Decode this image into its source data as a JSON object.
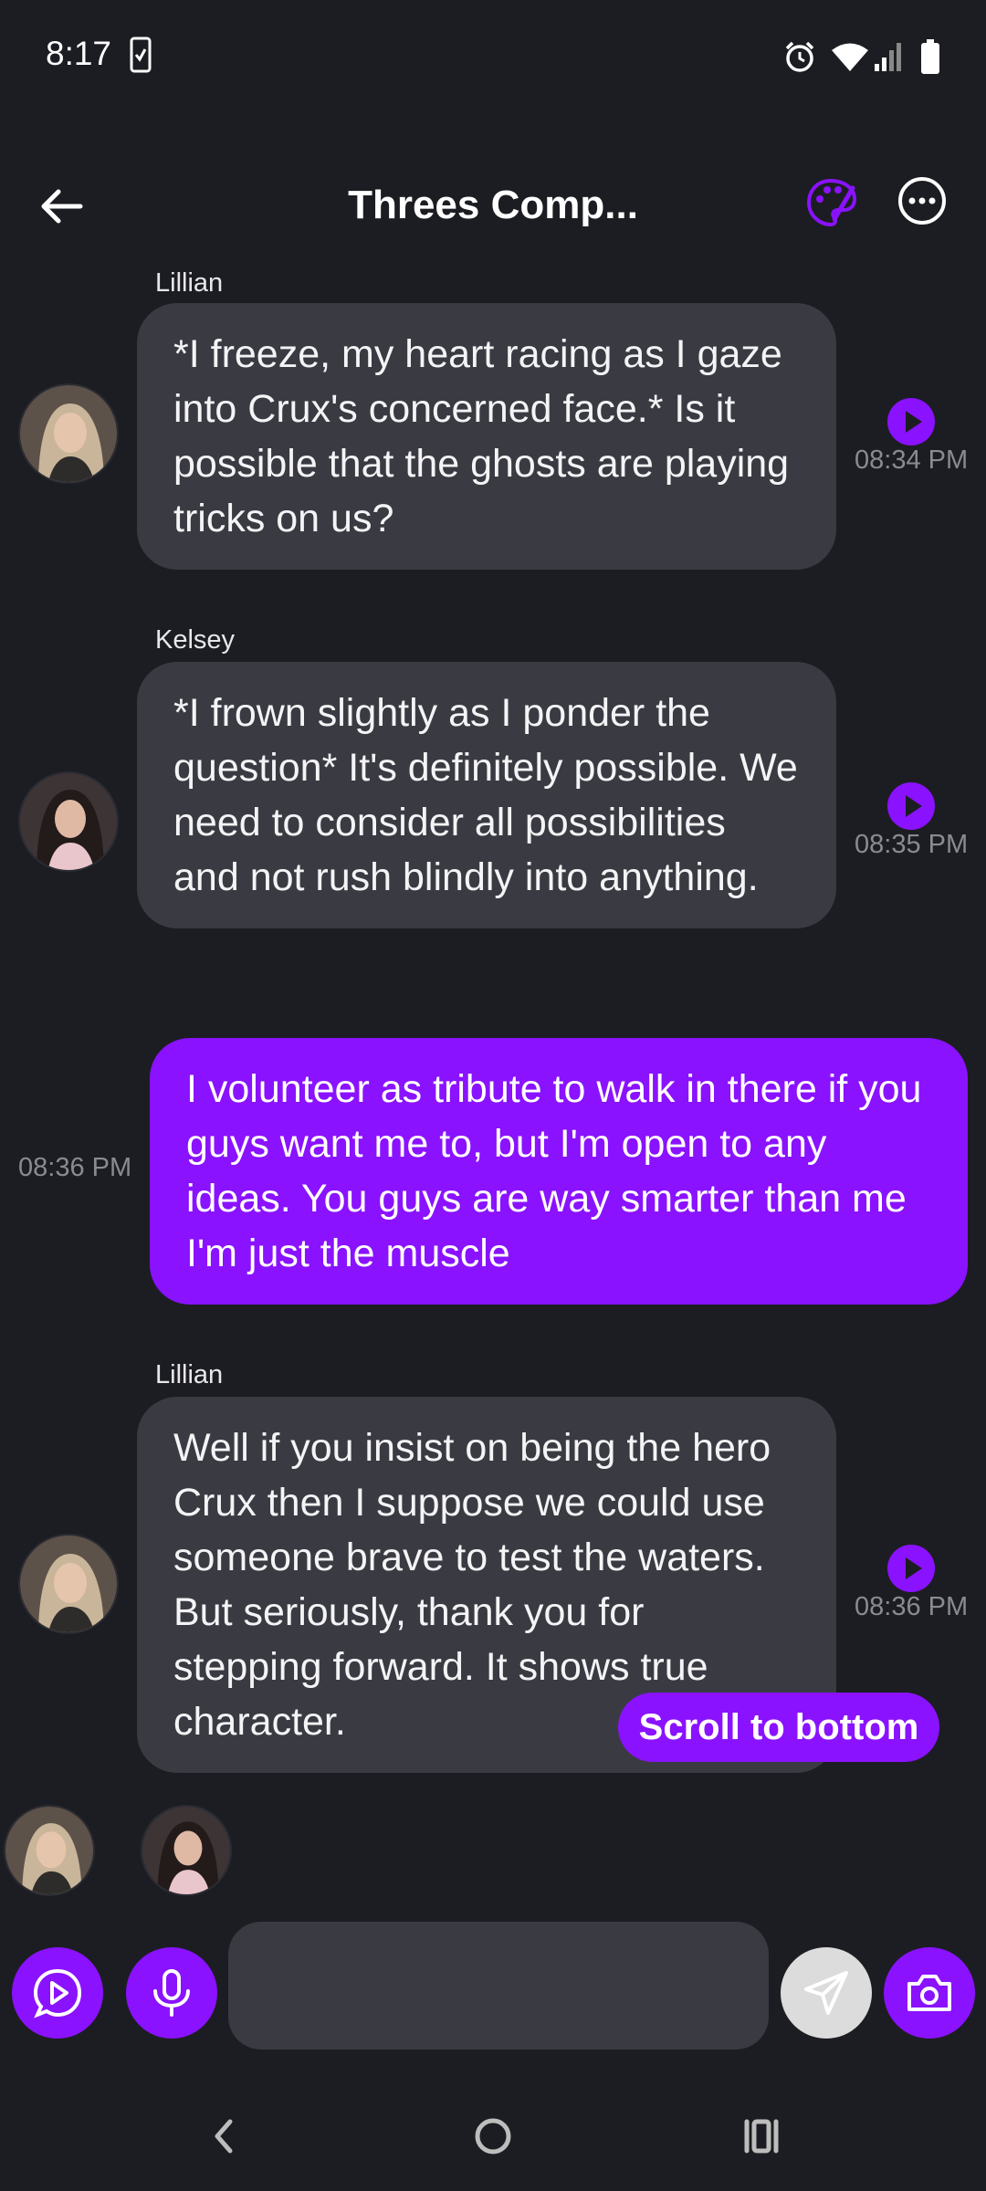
{
  "status_bar": {
    "time": "8:17"
  },
  "header": {
    "title": "Threes Comp..."
  },
  "messages": [
    {
      "sender": "Lillian",
      "text": "*I freeze, my heart racing as I gaze into Crux's concerned face.* Is it possible that the ghosts are playing tricks on us?",
      "time": "08:34 PM"
    },
    {
      "sender": "Kelsey",
      "text": "*I frown slightly as I ponder the question* It's definitely possible. We need to consider all possibilities and not rush blindly into anything.",
      "time": "08:35 PM"
    },
    {
      "sender": "",
      "text": "I volunteer as tribute to walk in there if you guys want me to, but I'm open to any ideas. You guys are way smarter than me I'm just the muscle",
      "time": "08:36 PM"
    },
    {
      "sender": "Lillian",
      "text": "Well if you insist on being the hero Crux then I suppose we could use someone brave to test the waters. But seriously, thank you for stepping forward. It shows true character.",
      "time": "08:36 PM"
    }
  ],
  "scroll_to_bottom": "Scroll to bottom",
  "composer": {
    "placeholder": ""
  },
  "colors": {
    "accent": "#8a12ff",
    "background": "#1c1d22",
    "bubble": "#3a3b42"
  }
}
